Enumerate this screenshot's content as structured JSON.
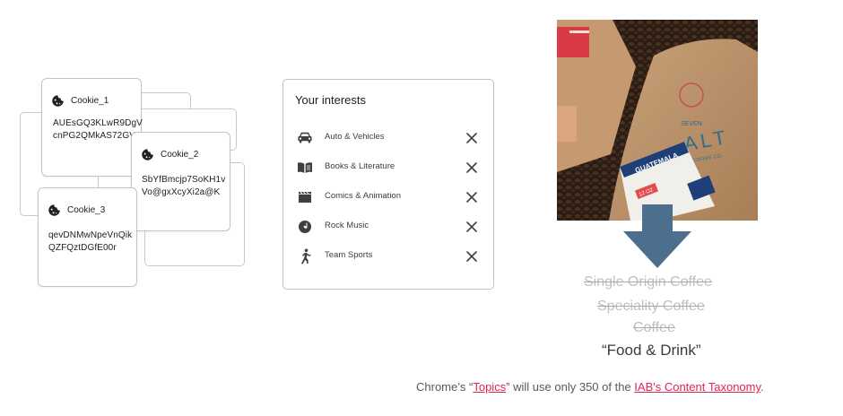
{
  "cookies": [
    {
      "name": "Cookie_1",
      "value": "AUEsGQ3KLwR9DgV\ncnPG2QMkAS72GV"
    },
    {
      "name": "Cookie_2",
      "value": "SbYfBmcjp7SoKH1v\nVo@gxXcyXi2a@K"
    },
    {
      "name": "Cookie_3",
      "value": "qevDNMwNpeVnQik\nQZFQztDGfE00r"
    }
  ],
  "interests": {
    "title": "Your interests",
    "items": [
      {
        "label": "Auto & Vehicles",
        "icon": "car-icon"
      },
      {
        "label": "Books & Literature",
        "icon": "book-icon"
      },
      {
        "label": "Comics & Animation",
        "icon": "clapperboard-icon"
      },
      {
        "label": "Rock Music",
        "icon": "music-disc-icon"
      },
      {
        "label": "Team Sports",
        "icon": "sports-figure-icon"
      }
    ]
  },
  "photo": {
    "bag_brand": "ALT",
    "bag_sub": "COFFEE CO.",
    "bag_top": "SEVEN",
    "bag_origin": "GUATEMALA",
    "bag_weight": "12 OZ"
  },
  "taxonomy": {
    "struck": [
      "Single Origin Coffee",
      "Speciality Coffee",
      "Coffee"
    ],
    "final": "“Food & Drink”"
  },
  "caption": {
    "before": "Chrome’s “",
    "link1": "Topics",
    "middle": "” will use only 350 of the ",
    "link2": "IAB's Content Taxonomy",
    "after": "."
  },
  "colors": {
    "arrow": "#4c6f8d",
    "link": "#e02454"
  }
}
